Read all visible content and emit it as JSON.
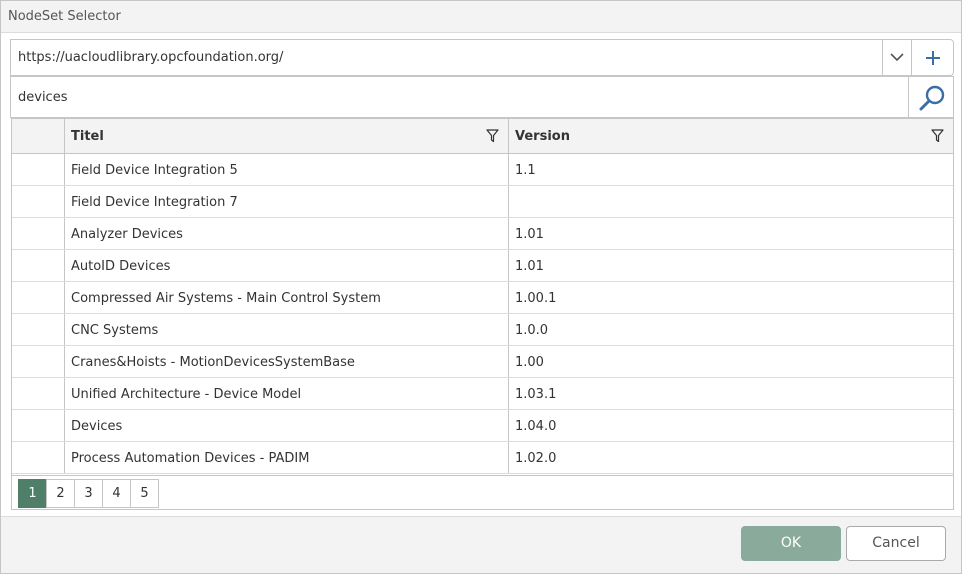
{
  "window": {
    "title": "NodeSet Selector"
  },
  "url_combo": {
    "value": "https://uacloudlibrary.opcfoundation.org/"
  },
  "search": {
    "value": "devices"
  },
  "grid": {
    "columns": [
      "",
      "Titel",
      "Version"
    ],
    "rows": [
      {
        "title": "Field Device Integration 5",
        "version": "1.1"
      },
      {
        "title": "Field Device Integration 7",
        "version": ""
      },
      {
        "title": "Analyzer Devices",
        "version": "1.01"
      },
      {
        "title": "AutoID Devices",
        "version": "1.01"
      },
      {
        "title": "Compressed Air Systems - Main Control System",
        "version": "1.00.1"
      },
      {
        "title": "CNC Systems",
        "version": "1.0.0"
      },
      {
        "title": "Cranes&Hoists - MotionDevicesSystemBase",
        "version": "1.00"
      },
      {
        "title": "Unified Architecture - Device Model",
        "version": "1.03.1"
      },
      {
        "title": "Devices",
        "version": "1.04.0"
      },
      {
        "title": "Process Automation Devices - PADIM",
        "version": "1.02.0"
      }
    ]
  },
  "pager": {
    "pages": [
      "1",
      "2",
      "3",
      "4",
      "5"
    ],
    "active": "1"
  },
  "footer": {
    "ok_label": "OK",
    "cancel_label": "Cancel"
  },
  "icons": {
    "dropdown": "chevron-down-icon",
    "add": "plus-icon",
    "search": "search-icon",
    "filter": "filter-icon"
  },
  "colors": {
    "accent": "#4f7f68",
    "ok_button": "#8aab9b",
    "icon_blue": "#3a6ea5"
  }
}
